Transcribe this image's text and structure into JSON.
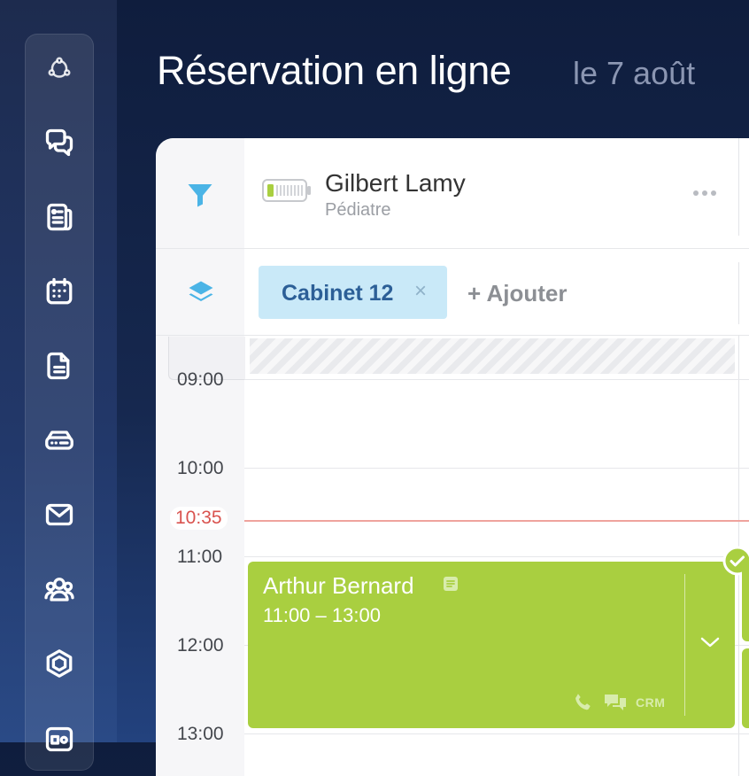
{
  "header": {
    "title": "Réservation en ligne",
    "date": "le 7 août"
  },
  "sidebar": {
    "items": [
      {
        "icon": "workflow-icon"
      },
      {
        "icon": "chat-icon"
      },
      {
        "icon": "news-icon"
      },
      {
        "icon": "calendar-icon"
      },
      {
        "icon": "document-icon"
      },
      {
        "icon": "storage-icon"
      },
      {
        "icon": "mail-icon"
      },
      {
        "icon": "users-icon"
      },
      {
        "icon": "hexagon-icon"
      },
      {
        "icon": "id-card-icon"
      }
    ]
  },
  "resource": {
    "name": "Gilbert Lamy",
    "role": "Pédiatre"
  },
  "filters": {
    "chip_label": "Cabinet 12",
    "chip_close": "×",
    "add_label": "+ Ajouter"
  },
  "timeline": {
    "hours": [
      "09:00",
      "10:00",
      "11:00",
      "12:00",
      "13:00"
    ],
    "now": "10:35"
  },
  "appointment": {
    "name": "Arthur Bernard",
    "time": "11:00 – 13:00",
    "crm": "CRM",
    "status": "confirmed"
  },
  "colors": {
    "appointment": "#a9cf40",
    "chip": "#c9e9f8",
    "accent": "#4bb4e6",
    "now_line": "#efa39d"
  }
}
